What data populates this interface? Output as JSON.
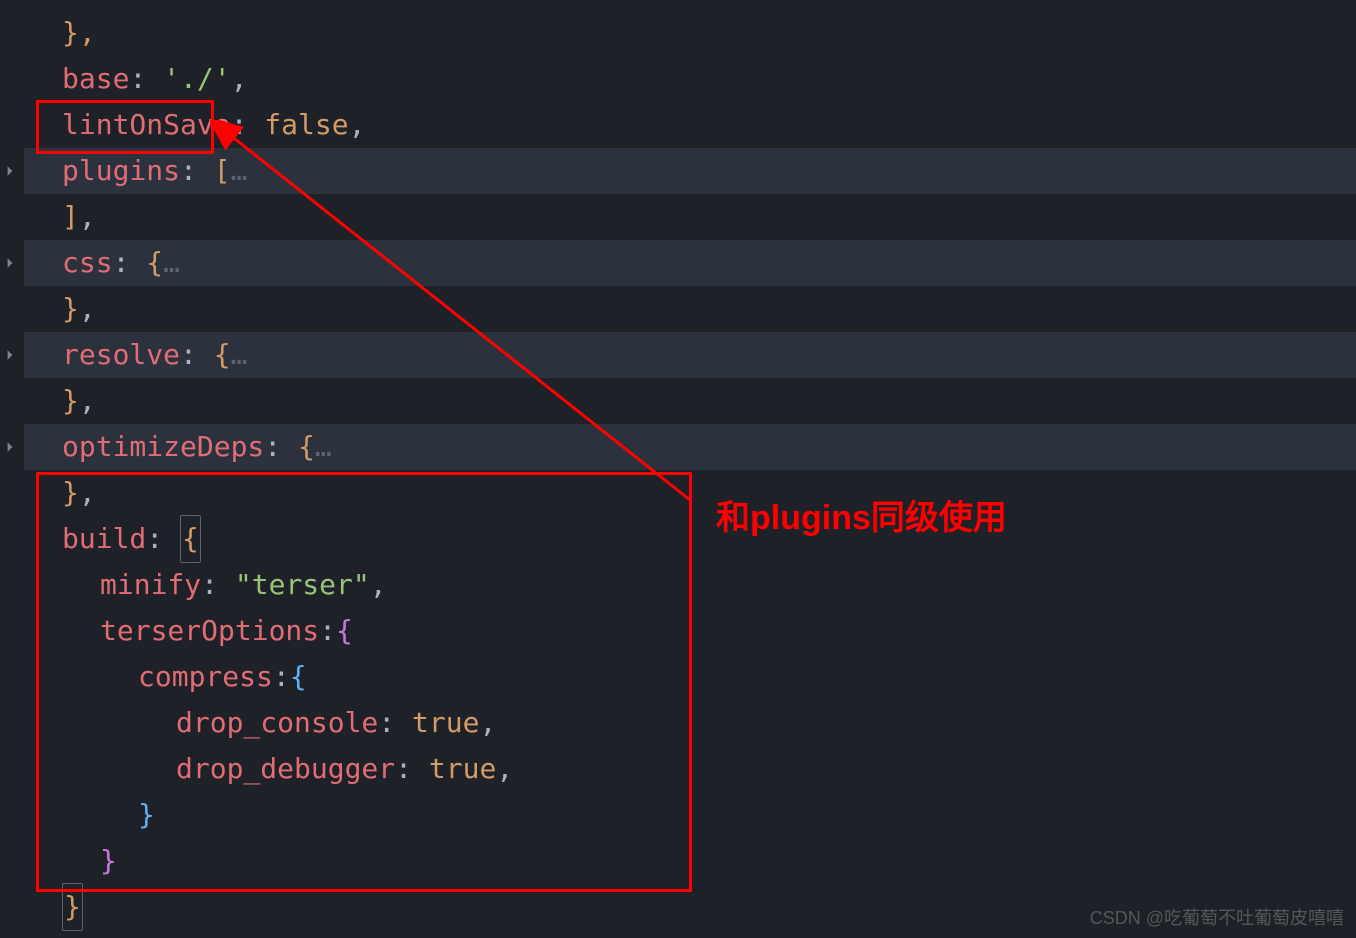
{
  "code": {
    "line1_brace": "},",
    "line2_key": "base",
    "line2_colon": ":",
    "line2_val": "'./'",
    "line2_comma": ",",
    "line3_key": "lintOnSave",
    "line3_colon": ":",
    "line3_val": "false",
    "line3_comma": ",",
    "line4_key": "plugins",
    "line4_colon": ":",
    "line4_bracket": "[",
    "line4_ellipsis": "…",
    "line5_bracket": "]",
    "line5_comma": ",",
    "line6_key": "css",
    "line6_colon": ":",
    "line6_brace": "{",
    "line6_ellipsis": "…",
    "line7_brace": "}",
    "line7_comma": ",",
    "line8_key": "resolve",
    "line8_colon": ":",
    "line8_brace": "{",
    "line8_ellipsis": "…",
    "line9_brace": "}",
    "line9_comma": ",",
    "line10_key": "optimizeDeps",
    "line10_colon": ":",
    "line10_brace": "{",
    "line10_ellipsis": "…",
    "line11_brace": "}",
    "line11_comma": ",",
    "line12_key": "build",
    "line12_colon": ":",
    "line12_brace": "{",
    "line13_key": "minify",
    "line13_colon": ":",
    "line13_val": "\"terser\"",
    "line13_comma": ",",
    "line14_key": "terserOptions",
    "line14_colon": ":",
    "line14_brace": "{",
    "line15_key": "compress",
    "line15_colon": ":",
    "line15_brace": "{",
    "line16_key": "drop_console",
    "line16_colon": ":",
    "line16_val": "true",
    "line16_comma": ",",
    "line17_key": "drop_debugger",
    "line17_colon": ":",
    "line17_val": "true",
    "line17_comma": ",",
    "line18_brace": "}",
    "line19_brace": "}",
    "line20_brace": "}"
  },
  "annotation_text": "和plugins同级使用",
  "watermark_text": "CSDN @吃葡萄不吐葡萄皮嘻嘻"
}
